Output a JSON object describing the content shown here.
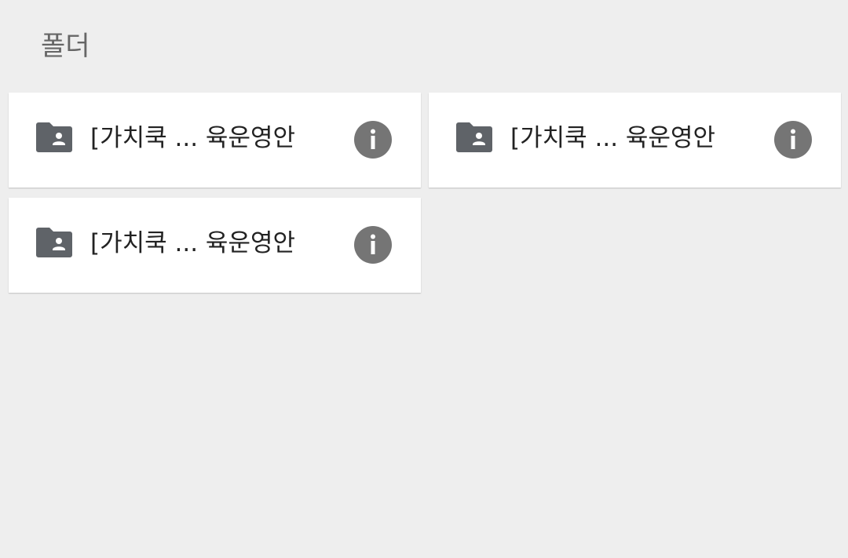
{
  "section": {
    "title": "폴더"
  },
  "folders": [
    {
      "name": "[가치쿡 ... 육운영안",
      "icon": "shared-folder-icon",
      "action_icon": "info-icon"
    },
    {
      "name": "[가치쿡 ... 육운영안",
      "icon": "shared-folder-icon",
      "action_icon": "info-icon"
    },
    {
      "name": "[가치쿡 ... 육운영안",
      "icon": "shared-folder-icon",
      "action_icon": "info-icon"
    }
  ],
  "colors": {
    "background": "#eeeeee",
    "card": "#ffffff",
    "icon": "#5f6368",
    "info_button": "#757575",
    "text": "#222222",
    "title": "#666666"
  }
}
